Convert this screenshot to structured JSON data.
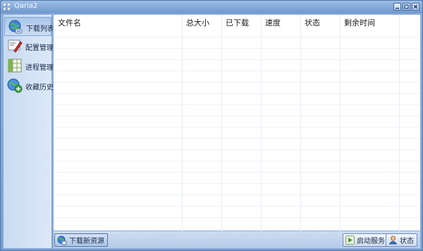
{
  "window": {
    "title": "Qaria2"
  },
  "sidebar": {
    "items": [
      {
        "label": "下载列表",
        "icon": "globe-download-icon",
        "selected": true
      },
      {
        "label": "配置管理",
        "icon": "settings-edit-icon",
        "selected": false
      },
      {
        "label": "进程管理",
        "icon": "process-grid-icon",
        "selected": false
      },
      {
        "label": "收藏历史",
        "icon": "favorites-history-icon",
        "selected": false
      }
    ]
  },
  "table": {
    "columns": [
      "文件名",
      "总大小",
      "已下载",
      "速度",
      "状态",
      "剩余时间"
    ],
    "rows": []
  },
  "bottombar": {
    "new_download_label": "下载新资源",
    "start_service_label": "启动服务",
    "status_label": "状态"
  }
}
